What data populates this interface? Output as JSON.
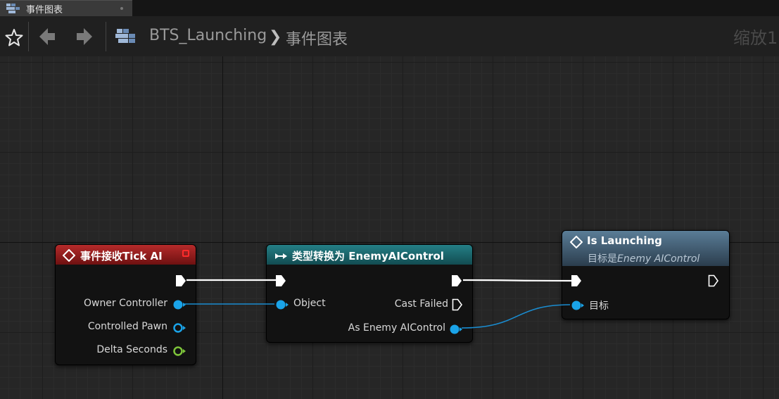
{
  "tab": {
    "title": "事件图表"
  },
  "toolbar": {
    "breadcrumb_asset": "BTS_Launching",
    "breadcrumb_graph": "事件图表",
    "zoom_label": "缩放1"
  },
  "nodes": {
    "tick": {
      "title": "事件接收Tick AI",
      "color": "#8c1c1c",
      "pins": {
        "owner": "Owner Controller",
        "pawn": "Controlled Pawn",
        "delta": "Delta Seconds"
      }
    },
    "cast": {
      "title": "类型转换为 EnemyAIControl",
      "color": "#1b6b70",
      "pins": {
        "object": "Object",
        "failed": "Cast Failed",
        "as_enemy": "As Enemy AIControl"
      }
    },
    "launch": {
      "title": "Is Launching",
      "subtitle_prefix": "目标是",
      "subtitle_class": "Enemy AIControl",
      "color": "#41596e",
      "pins": {
        "target": "目标"
      }
    }
  },
  "colors": {
    "object_pin": "#1aa3e8",
    "float_pin": "#7ec53a",
    "exec_pin": "#ffffff"
  }
}
